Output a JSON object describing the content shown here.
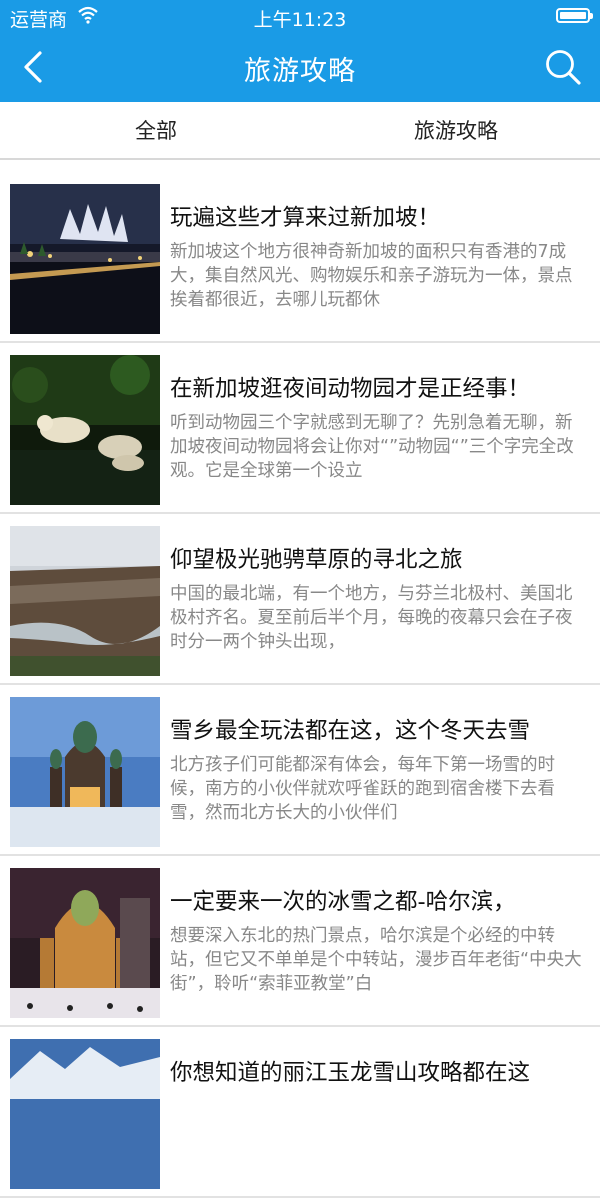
{
  "status_bar": {
    "carrier": "运营商",
    "time": "上午11:23"
  },
  "nav": {
    "title": "旅游攻略"
  },
  "tabs": [
    {
      "label": "全部"
    },
    {
      "label": "旅游攻略"
    }
  ],
  "articles": [
    {
      "title": "玩遍这些才算来过新加坡！",
      "desc": "新加坡这个地方很神奇新加坡的面积只有香港的7成大，集自然风光、购物娱乐和亲子游玩为一体，景点挨着都很近，去哪儿玩都休"
    },
    {
      "title": "在新加坡逛夜间动物园才是正经事！",
      "desc": "听到动物园三个字就感到无聊了？先别急着无聊，新加坡夜间动物园将会让你对“”动物园“”三个字完全改观。它是全球第一个设立"
    },
    {
      "title": "仰望极光驰骋草原的寻北之旅",
      "desc": "中国的最北端，有一个地方，与芬兰北极村、美国北极村齐名。夏至前后半个月，每晚的夜幕只会在子夜时分一两个钟头出现，"
    },
    {
      "title": "雪乡最全玩法都在这，这个冬天去雪",
      "desc": "北方孩子们可能都深有体会，每年下第一场雪的时候，南方的小伙伴就欢呼雀跃的跑到宿舍楼下去看雪，然而北方长大的小伙伴们"
    },
    {
      "title": "一定要来一次的冰雪之都-哈尔滨，",
      "desc": "想要深入东北的热门景点，哈尔滨是个必经的中转站，但它又不单单是个中转站，漫步百年老街“中央大街”，聆听“索菲亚教堂”白"
    },
    {
      "title": "你想知道的丽江玉龙雪山攻略都在这",
      "desc": ""
    }
  ]
}
